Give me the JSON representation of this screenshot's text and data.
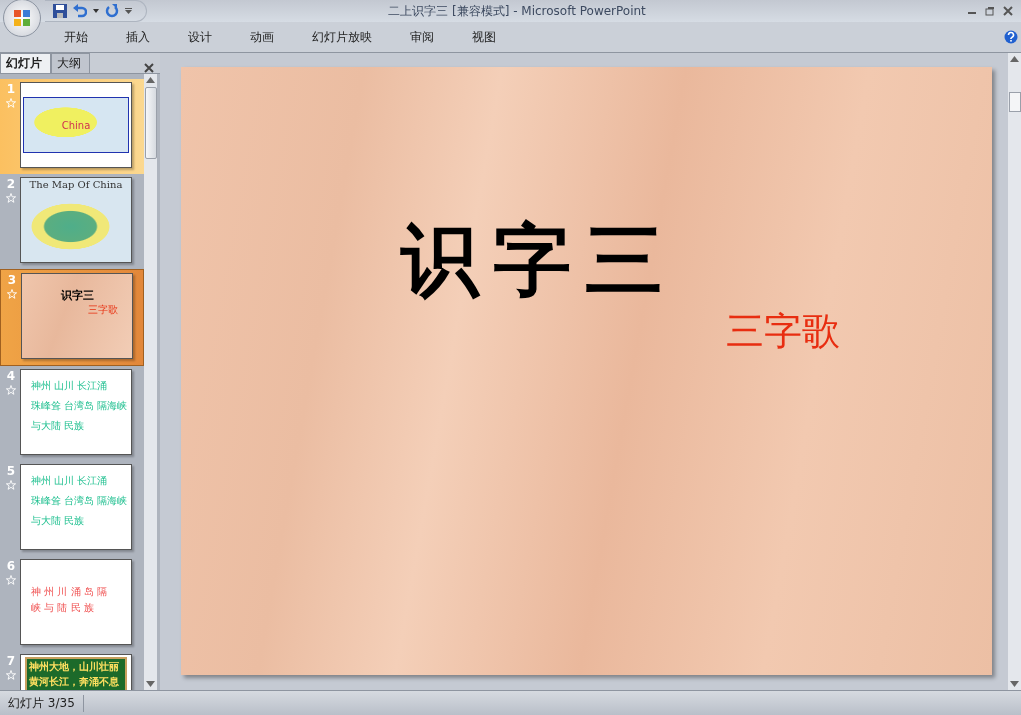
{
  "window": {
    "title": "二上识字三 [兼容模式] - Microsoft PowerPoint"
  },
  "ribbon_tabs": [
    {
      "label": "开始",
      "selected": false
    },
    {
      "label": "插入",
      "selected": false
    },
    {
      "label": "设计",
      "selected": false
    },
    {
      "label": "动画",
      "selected": false
    },
    {
      "label": "幻灯片放映",
      "selected": false
    },
    {
      "label": "审阅",
      "selected": false
    },
    {
      "label": "视图",
      "selected": false
    }
  ],
  "pane_tabs": [
    {
      "label": "幻灯片",
      "selected": true
    },
    {
      "label": "大纲",
      "selected": false
    }
  ],
  "slides": [
    {
      "number": "1",
      "selected": false,
      "kind": "map",
      "lines": [
        "China"
      ]
    },
    {
      "number": "2",
      "selected": false,
      "kind": "map2",
      "lines": [
        "The Map Of China"
      ]
    },
    {
      "number": "3",
      "selected": true,
      "kind": "title",
      "lines": [
        "识字三",
        "三字歌"
      ]
    },
    {
      "number": "4",
      "selected": false,
      "kind": "text",
      "lines": [
        "神州 山川 长江涌",
        "珠峰耸 台湾岛 隔海峡",
        "与大陆 民族"
      ]
    },
    {
      "number": "5",
      "selected": false,
      "kind": "text",
      "lines": [
        "神州 山川 长江涌",
        "珠峰耸 台湾岛 隔海峡",
        "与大陆 民族"
      ]
    },
    {
      "number": "6",
      "selected": false,
      "kind": "chars",
      "lines": [
        "神 州 川 涌 岛 隔",
        "峡 与 陆 民 族"
      ]
    },
    {
      "number": "7",
      "selected": false,
      "kind": "banner",
      "lines": [
        "神州大地，山川壮丽",
        "黄河长江，奔涌不息"
      ]
    }
  ],
  "slide": {
    "title": "识字三",
    "subtitle": "三字歌"
  },
  "status_bar": {
    "text": "幻灯片 3/35"
  }
}
